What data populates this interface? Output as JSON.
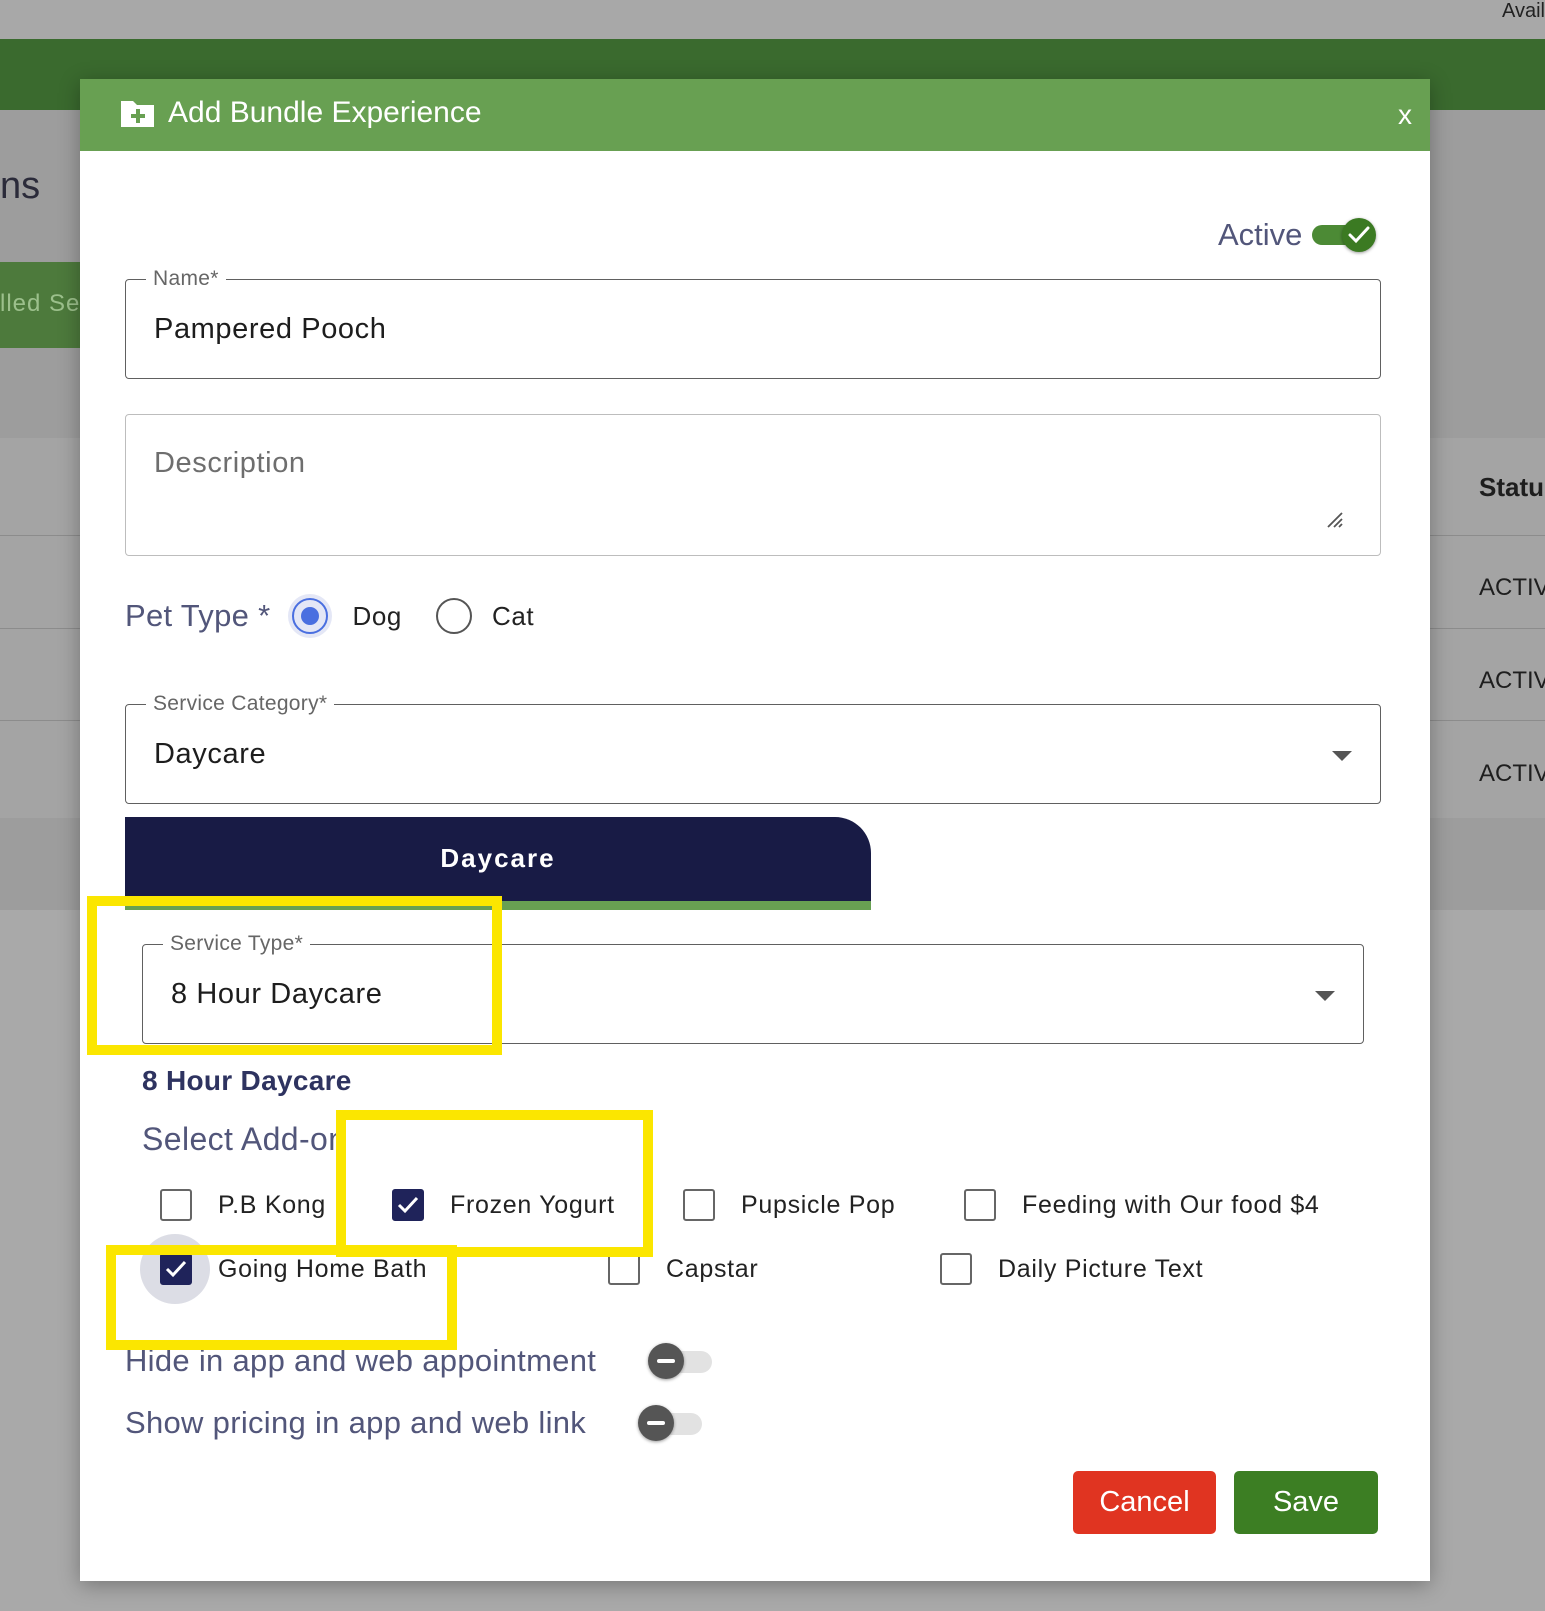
{
  "background": {
    "top_right_text": "Avail",
    "heading_fragment": "ns",
    "tab_fragment": "lled Se",
    "status_header": "Status",
    "status_rows": [
      "ACTIVE",
      "ACTIVE",
      "ACTIVE"
    ]
  },
  "modal": {
    "title": "Add Bundle Experience",
    "close_label": "x",
    "active_label": "Active",
    "active_on": true,
    "name": {
      "label": "Name*",
      "value": "Pampered Pooch"
    },
    "description": {
      "placeholder": "Description"
    },
    "pet_type": {
      "label": "Pet Type *",
      "options": [
        {
          "label": "Dog",
          "selected": true
        },
        {
          "label": "Cat",
          "selected": false
        }
      ]
    },
    "service_category": {
      "label": "Service Category*",
      "value": "Daycare"
    },
    "category_tab": "Daycare",
    "service_type": {
      "label": "Service Type*",
      "value": "8 Hour Daycare"
    },
    "section_title": "8 Hour Daycare",
    "addons_label": "Select Add-on",
    "addons": [
      {
        "label": "P.B Kong",
        "checked": false
      },
      {
        "label": "Frozen Yogurt",
        "checked": true
      },
      {
        "label": "Pupsicle Pop",
        "checked": false
      },
      {
        "label": "Feeding with Our food $4",
        "checked": false
      },
      {
        "label": "Going Home Bath",
        "checked": true
      },
      {
        "label": "Capstar",
        "checked": false
      },
      {
        "label": "Daily Picture Text",
        "checked": false
      }
    ],
    "hide_in_app": {
      "label": "Hide in app and web appointment",
      "on": false
    },
    "show_pricing": {
      "label": "Show pricing in app and web link",
      "on": false
    },
    "cancel_label": "Cancel",
    "save_label": "Save"
  },
  "colors": {
    "header_green": "#68a052",
    "tab_navy": "#181b45",
    "highlight_yellow": "#fbe600",
    "cancel_red": "#e03421",
    "save_green": "#3c7e23"
  }
}
